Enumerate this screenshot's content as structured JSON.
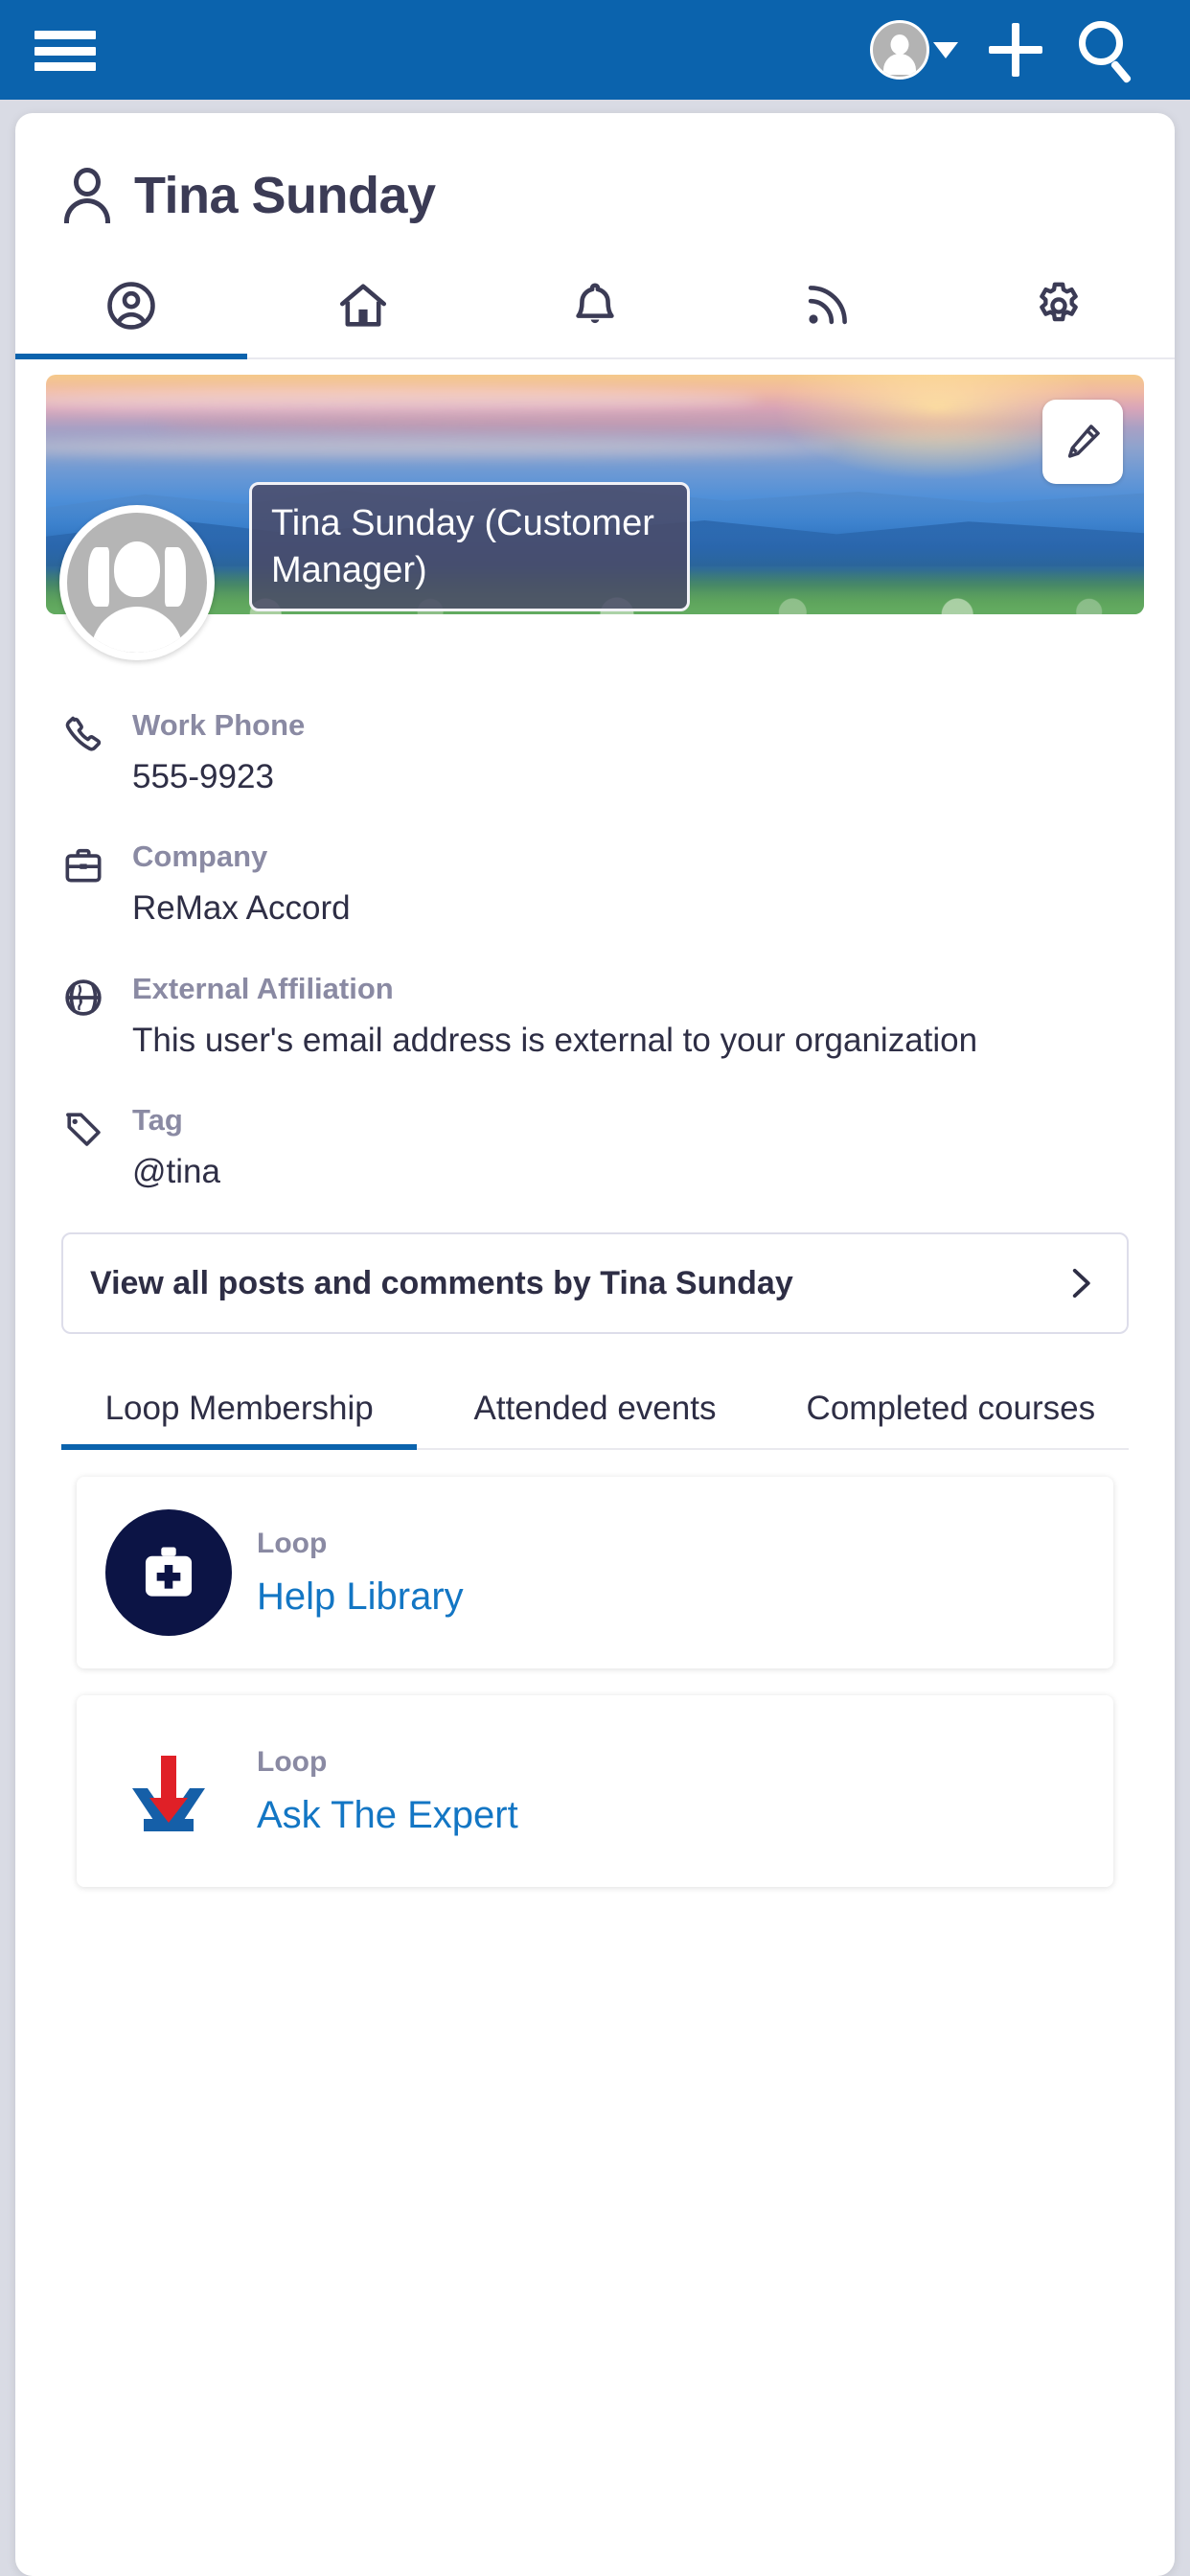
{
  "appbar": {
    "menu_icon": "hamburger-menu-icon",
    "avatar_icon": "user-avatar-icon",
    "dropdown_icon": "chevron-down-icon",
    "add_icon": "plus-icon",
    "search_icon": "search-icon",
    "background_color": "#0b63ad"
  },
  "profile": {
    "icon": "person-outline-icon",
    "name": "Tina Sunday",
    "badge_text": "Tina Sunday  (Customer Manager)",
    "edit_icon": "pencil-edit-icon",
    "avatar_icon": "female-avatar-placeholder-icon"
  },
  "icon_tabs": [
    {
      "name": "profile",
      "icon": "user-circle-icon",
      "active": true
    },
    {
      "name": "home",
      "icon": "home-icon",
      "active": false
    },
    {
      "name": "notifications",
      "icon": "bell-icon",
      "active": false
    },
    {
      "name": "feed",
      "icon": "rss-feed-icon",
      "active": false
    },
    {
      "name": "settings",
      "icon": "gear-icon",
      "active": false
    }
  ],
  "details": [
    {
      "icon": "phone-icon",
      "label": "Work Phone",
      "value": "555-9923"
    },
    {
      "icon": "briefcase-icon",
      "label": "Company",
      "value": "ReMax Accord"
    },
    {
      "icon": "globe-icon",
      "label": "External Affiliation",
      "value": "This user's email address is external to your organization"
    },
    {
      "icon": "tag-icon",
      "label": "Tag",
      "value": "@tina"
    }
  ],
  "view_all": {
    "label": "View all posts and comments by Tina Sunday",
    "chevron_icon": "chevron-right-icon"
  },
  "text_tabs": [
    {
      "label": "Loop Membership",
      "active": true
    },
    {
      "label": "Attended events",
      "active": false
    },
    {
      "label": "Completed courses",
      "active": false
    }
  ],
  "loops": [
    {
      "kind": "Loop",
      "name": "Help Library",
      "logo": "medical-kit-icon"
    },
    {
      "kind": "Loop",
      "name": "Ask The Expert",
      "logo": "red-arrow-logo-icon"
    }
  ],
  "colors": {
    "primary_blue": "#0b63ad",
    "link_blue": "#1376c4",
    "dark_navy": "#0c1445",
    "text_dark": "#2e2e45",
    "text_muted": "#8a8aa3"
  }
}
